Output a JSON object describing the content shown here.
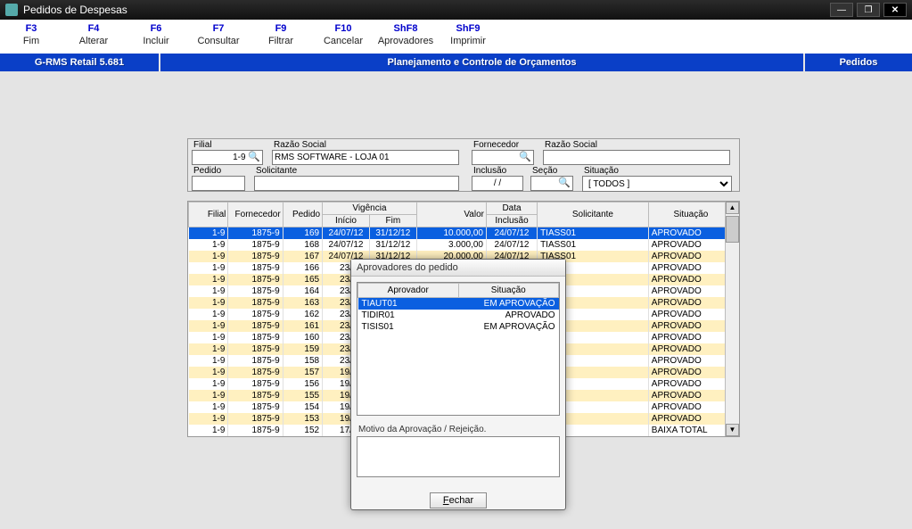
{
  "window": {
    "title": "Pedidos de Despesas"
  },
  "menu": [
    {
      "fk": "F3",
      "label": "Fim"
    },
    {
      "fk": "F4",
      "label": "Alterar"
    },
    {
      "fk": "F6",
      "label": "Incluir"
    },
    {
      "fk": "F7",
      "label": "Consultar"
    },
    {
      "fk": "F9",
      "label": "Filtrar"
    },
    {
      "fk": "F10",
      "label": "Cancelar"
    },
    {
      "fk": "ShF8",
      "label": "Aprovadores"
    },
    {
      "fk": "ShF9",
      "label": "Imprimir"
    }
  ],
  "bluebar": {
    "left": "G-RMS Retail 5.681",
    "center": "Planejamento e Controle de Orçamentos",
    "right": "Pedidos"
  },
  "filter": {
    "labels": {
      "filial": "Filial",
      "razao1": "Razão Social",
      "fornecedor": "Fornecedor",
      "razao2": "Razão Social",
      "pedido": "Pedido",
      "solicitante": "Solicitante",
      "inclusao": "Inclusão",
      "secao": "Seção",
      "situacao": "Situação"
    },
    "values": {
      "filial": "1-9",
      "razao1": "RMS SOFTWARE - LOJA 01",
      "fornecedor": "",
      "razao2": "",
      "pedido": "",
      "solicitante": "",
      "inclusao": "  /  /",
      "secao": "",
      "situacao": "[ TODOS ]"
    }
  },
  "grid": {
    "headers": {
      "filial": "Filial",
      "fornecedor": "Fornecedor",
      "pedido": "Pedido",
      "vigencia": "Vigência",
      "inicio": "Início",
      "fim": "Fim",
      "valor": "Valor",
      "data": "Data",
      "inclusao": "Inclusão",
      "solicitante": "Solicitante",
      "situacao": "Situação"
    },
    "rows": [
      {
        "filial": "1-9",
        "forn": "1875-9",
        "ped": "169",
        "ini": "24/07/12",
        "fim": "31/12/12",
        "valor": "10.000,00",
        "data": "24/07/12",
        "sol": "TIASS01",
        "sit": "APROVADO",
        "sel": true
      },
      {
        "filial": "1-9",
        "forn": "1875-9",
        "ped": "168",
        "ini": "24/07/12",
        "fim": "31/12/12",
        "valor": "3.000,00",
        "data": "24/07/12",
        "sol": "TIASS01",
        "sit": "APROVADO"
      },
      {
        "filial": "1-9",
        "forn": "1875-9",
        "ped": "167",
        "ini": "24/07/12",
        "fim": "31/12/12",
        "valor": "20.000,00",
        "data": "24/07/12",
        "sol": "TIASS01",
        "sit": "APROVADO",
        "alt": true
      },
      {
        "filial": "1-9",
        "forn": "1875-9",
        "ped": "166",
        "ini": "23/",
        "fim": "",
        "valor": "",
        "data": "",
        "sol": "",
        "sit": "APROVADO"
      },
      {
        "filial": "1-9",
        "forn": "1875-9",
        "ped": "165",
        "ini": "23/",
        "fim": "",
        "valor": "",
        "data": "",
        "sol": "",
        "sit": "APROVADO",
        "alt": true
      },
      {
        "filial": "1-9",
        "forn": "1875-9",
        "ped": "164",
        "ini": "23/",
        "fim": "",
        "valor": "",
        "data": "",
        "sol": "",
        "sit": "APROVADO"
      },
      {
        "filial": "1-9",
        "forn": "1875-9",
        "ped": "163",
        "ini": "23/",
        "fim": "",
        "valor": "",
        "data": "",
        "sol": "",
        "sit": "APROVADO",
        "alt": true
      },
      {
        "filial": "1-9",
        "forn": "1875-9",
        "ped": "162",
        "ini": "23/",
        "fim": "",
        "valor": "",
        "data": "",
        "sol": "",
        "sit": "APROVADO"
      },
      {
        "filial": "1-9",
        "forn": "1875-9",
        "ped": "161",
        "ini": "23/",
        "fim": "",
        "valor": "",
        "data": "",
        "sol": "",
        "sit": "APROVADO",
        "alt": true
      },
      {
        "filial": "1-9",
        "forn": "1875-9",
        "ped": "160",
        "ini": "23/",
        "fim": "",
        "valor": "",
        "data": "",
        "sol": "",
        "sit": "APROVADO"
      },
      {
        "filial": "1-9",
        "forn": "1875-9",
        "ped": "159",
        "ini": "23/",
        "fim": "",
        "valor": "",
        "data": "",
        "sol": "",
        "sit": "APROVADO",
        "alt": true
      },
      {
        "filial": "1-9",
        "forn": "1875-9",
        "ped": "158",
        "ini": "23/",
        "fim": "",
        "valor": "",
        "data": "",
        "sol": "",
        "sit": "APROVADO"
      },
      {
        "filial": "1-9",
        "forn": "1875-9",
        "ped": "157",
        "ini": "19/",
        "fim": "",
        "valor": "",
        "data": "",
        "sol": "",
        "sit": "APROVADO",
        "alt": true
      },
      {
        "filial": "1-9",
        "forn": "1875-9",
        "ped": "156",
        "ini": "19/",
        "fim": "",
        "valor": "",
        "data": "",
        "sol": "",
        "sit": "APROVADO"
      },
      {
        "filial": "1-9",
        "forn": "1875-9",
        "ped": "155",
        "ini": "19/",
        "fim": "",
        "valor": "",
        "data": "",
        "sol": "",
        "sit": "APROVADO",
        "alt": true
      },
      {
        "filial": "1-9",
        "forn": "1875-9",
        "ped": "154",
        "ini": "19/",
        "fim": "",
        "valor": "",
        "data": "",
        "sol": "",
        "sit": "APROVADO"
      },
      {
        "filial": "1-9",
        "forn": "1875-9",
        "ped": "153",
        "ini": "19/",
        "fim": "",
        "valor": "",
        "data": "",
        "sol": "",
        "sit": "APROVADO",
        "alt": true
      },
      {
        "filial": "1-9",
        "forn": "1875-9",
        "ped": "152",
        "ini": "17/",
        "fim": "",
        "valor": "",
        "data": "",
        "sol": "",
        "sit": "BAIXA TOTAL"
      }
    ]
  },
  "modal": {
    "title": "Aprovadores do pedido",
    "headers": {
      "aprovador": "Aprovador",
      "situacao": "Situação"
    },
    "rows": [
      {
        "aprov": "TIAUT01",
        "sit": "EM APROVAÇÃO",
        "sel": true
      },
      {
        "aprov": "TIDIR01",
        "sit": "APROVADO"
      },
      {
        "aprov": "TISIS01",
        "sit": "EM APROVAÇÃO"
      }
    ],
    "motivo_label": "Motivo da Aprovação / Rejeição.",
    "motivo_value": "",
    "close_prefix": "F",
    "close_rest": "echar"
  }
}
